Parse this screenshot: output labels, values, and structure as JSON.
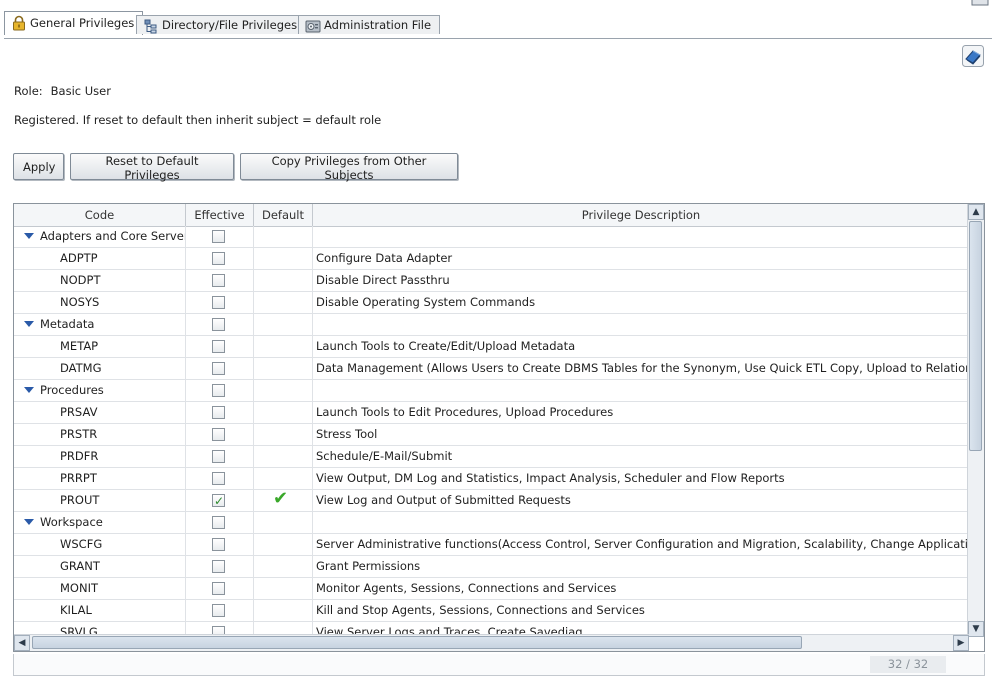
{
  "tabs": [
    {
      "label": "General Privileges",
      "icon": "lock-icon",
      "active": true
    },
    {
      "label": "Directory/File Privileges",
      "icon": "folder-tree-icon",
      "active": false
    },
    {
      "label": "Administration File",
      "icon": "admin-file-icon",
      "active": false
    }
  ],
  "role": {
    "label": "Role:",
    "value": "Basic User"
  },
  "note": "Registered. If reset to default then inherit subject = default role",
  "buttons": {
    "apply": "Apply",
    "reset": "Reset to Default Privileges",
    "copy": "Copy Privileges from Other Subjects"
  },
  "grid": {
    "headers": {
      "code": "Code",
      "effective": "Effective",
      "default": "Default",
      "description": "Privilege Description"
    },
    "rows": [
      {
        "type": "group",
        "code": "Adapters and Core Server",
        "effective": false,
        "default": false,
        "description": ""
      },
      {
        "type": "item",
        "code": "ADPTP",
        "effective": false,
        "default": false,
        "description": "Configure Data Adapter"
      },
      {
        "type": "item",
        "code": "NODPT",
        "effective": false,
        "default": false,
        "description": "Disable Direct Passthru"
      },
      {
        "type": "item",
        "code": "NOSYS",
        "effective": false,
        "default": false,
        "description": "Disable Operating System Commands"
      },
      {
        "type": "group",
        "code": "Metadata",
        "effective": false,
        "default": false,
        "description": ""
      },
      {
        "type": "item",
        "code": "METAP",
        "effective": false,
        "default": false,
        "description": "Launch Tools to Create/Edit/Upload Metadata"
      },
      {
        "type": "item",
        "code": "DATMG",
        "effective": false,
        "default": false,
        "description": "Data Management (Allows Users to Create DBMS Tables for the Synonym, Use Quick ETL Copy, Upload to Relational Da"
      },
      {
        "type": "group",
        "code": "Procedures",
        "effective": false,
        "default": false,
        "description": ""
      },
      {
        "type": "item",
        "code": "PRSAV",
        "effective": false,
        "default": false,
        "description": "Launch Tools to Edit Procedures, Upload Procedures"
      },
      {
        "type": "item",
        "code": "PRSTR",
        "effective": false,
        "default": false,
        "description": "Stress Tool"
      },
      {
        "type": "item",
        "code": "PRDFR",
        "effective": false,
        "default": false,
        "description": "Schedule/E-Mail/Submit"
      },
      {
        "type": "item",
        "code": "PRRPT",
        "effective": false,
        "default": false,
        "description": "View Output, DM Log and Statistics, Impact Analysis, Scheduler and Flow Reports"
      },
      {
        "type": "item",
        "code": "PROUT",
        "effective": true,
        "default": true,
        "description": "View Log and Output of Submitted Requests"
      },
      {
        "type": "group",
        "code": "Workspace",
        "effective": false,
        "default": false,
        "description": ""
      },
      {
        "type": "item",
        "code": "WSCFG",
        "effective": false,
        "default": false,
        "description": "Server Administrative functions(Access Control, Server Configuration and Migration, Scalability, Change Application Path"
      },
      {
        "type": "item",
        "code": "GRANT",
        "effective": false,
        "default": false,
        "description": "Grant Permissions"
      },
      {
        "type": "item",
        "code": "MONIT",
        "effective": false,
        "default": false,
        "description": "Monitor Agents, Sessions, Connections and Services"
      },
      {
        "type": "item",
        "code": "KILAL",
        "effective": false,
        "default": false,
        "description": "Kill and Stop Agents, Sessions, Connections and Services"
      },
      {
        "type": "item",
        "code": "SRVLG",
        "effective": false,
        "default": false,
        "description": "View Server Logs and Traces, Create Savediag"
      }
    ]
  },
  "footer": {
    "count": "32 / 32"
  }
}
